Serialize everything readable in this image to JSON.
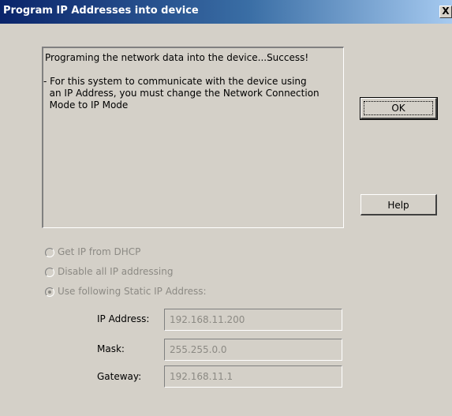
{
  "window": {
    "title": "Program IP Addresses into device",
    "close_label": "X"
  },
  "message": {
    "lines": [
      "Programing the network data into the device...Success!",
      "- For this system to communicate with the device using",
      "  an IP Address, you must change the Network Connection",
      "  Mode to IP Mode"
    ]
  },
  "buttons": {
    "ok_label": "OK",
    "help_label": "Help"
  },
  "options": [
    {
      "label": "Get IP from DHCP",
      "selected": false,
      "enabled": false
    },
    {
      "label": "Disable all IP addressing",
      "selected": false,
      "enabled": false
    },
    {
      "label": "Use following Static IP Address:",
      "selected": true,
      "enabled": false
    }
  ],
  "fields": {
    "ip_address": {
      "label": "IP Address:",
      "value": "192.168.11.200"
    },
    "mask": {
      "label": "Mask:",
      "value": "255.255.0.0"
    },
    "gateway": {
      "label": "Gateway:",
      "value": "192.168.11.1"
    }
  }
}
